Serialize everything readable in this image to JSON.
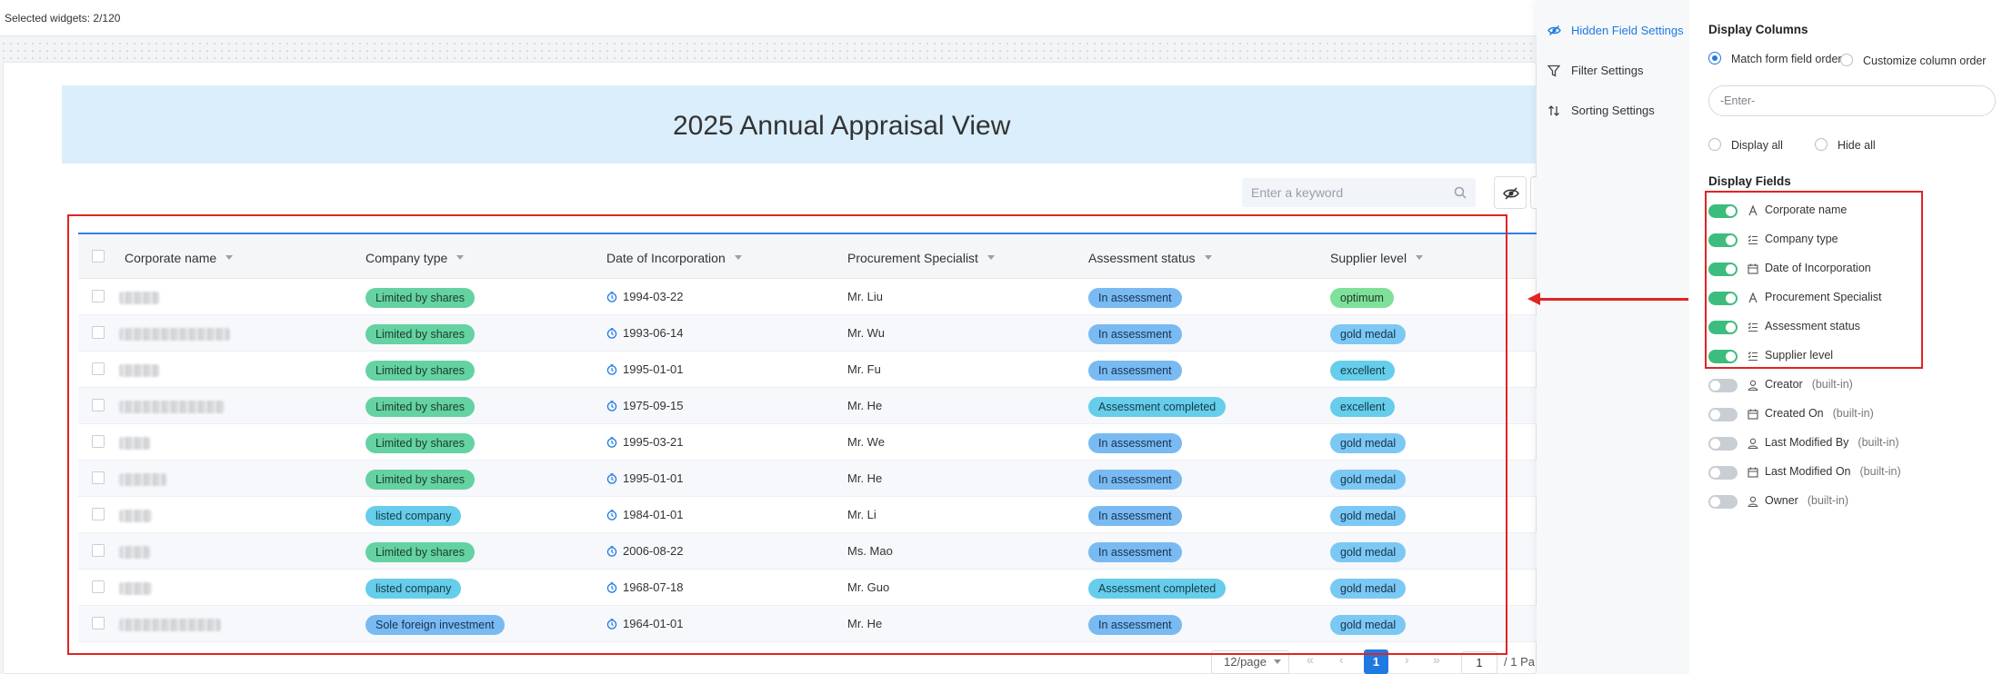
{
  "topbar": {
    "selected": "Selected widgets: 2/120"
  },
  "view": {
    "title": "2025 Annual Appraisal View"
  },
  "search": {
    "placeholder": "Enter a keyword"
  },
  "table": {
    "columns": [
      "Corporate name",
      "Company type",
      "Date of Incorporation",
      "Procurement Specialist",
      "Assessment status",
      "Supplier level"
    ],
    "rows": [
      {
        "company_type": "Limited by shares",
        "type_color": "green",
        "date": "1994-03-22",
        "specialist": "Mr. Liu",
        "status": "In assessment",
        "status_color": "blue",
        "level": "optimum",
        "level_color": "lime"
      },
      {
        "company_type": "Limited by shares",
        "type_color": "green",
        "date": "1993-06-14",
        "specialist": "Mr. Wu",
        "status": "In assessment",
        "status_color": "blue",
        "level": "gold medal",
        "level_color": "sky"
      },
      {
        "company_type": "Limited by shares",
        "type_color": "green",
        "date": "1995-01-01",
        "specialist": "Mr. Fu",
        "status": "In assessment",
        "status_color": "blue",
        "level": "excellent",
        "level_color": "cyan"
      },
      {
        "company_type": "Limited by shares",
        "type_color": "green",
        "date": "1975-09-15",
        "specialist": "Mr. He",
        "status": "Assessment completed",
        "status_color": "cyan",
        "level": "excellent",
        "level_color": "cyan"
      },
      {
        "company_type": "Limited by shares",
        "type_color": "green",
        "date": "1995-03-21",
        "specialist": "Mr. We",
        "status": "In assessment",
        "status_color": "blue",
        "level": "gold medal",
        "level_color": "sky"
      },
      {
        "company_type": "Limited by shares",
        "type_color": "green",
        "date": "1995-01-01",
        "specialist": "Mr. He",
        "status": "In assessment",
        "status_color": "blue",
        "level": "gold medal",
        "level_color": "sky"
      },
      {
        "company_type": "listed company",
        "type_color": "cyan",
        "date": "1984-01-01",
        "specialist": "Mr. Li",
        "status": "In assessment",
        "status_color": "blue",
        "level": "gold medal",
        "level_color": "sky"
      },
      {
        "company_type": "Limited by shares",
        "type_color": "green",
        "date": "2006-08-22",
        "specialist": "Ms. Mao",
        "status": "In assessment",
        "status_color": "blue",
        "level": "gold medal",
        "level_color": "sky"
      },
      {
        "company_type": "listed company",
        "type_color": "cyan",
        "date": "1968-07-18",
        "specialist": "Mr. Guo",
        "status": "Assessment completed",
        "status_color": "cyan",
        "level": "gold medal",
        "level_color": "sky"
      },
      {
        "company_type": "Sole foreign investment",
        "type_color": "blue",
        "date": "1964-01-01",
        "specialist": "Mr. He",
        "status": "In assessment",
        "status_color": "blue",
        "level": "gold medal",
        "level_color": "sky"
      }
    ]
  },
  "pagination": {
    "page_size": "12/page",
    "current": "1",
    "jump": "1",
    "total": "/ 1 Pa"
  },
  "panel": {
    "nav": [
      "Hidden Field Settings",
      "Filter Settings",
      "Sorting Settings"
    ],
    "display_columns": "Display Columns",
    "match_order": "Match form field order",
    "customize_order": "Customize column order",
    "enter_placeholder": "-Enter-",
    "display_all": "Display all",
    "hide_all": "Hide all",
    "display_fields": "Display Fields",
    "fields": [
      {
        "label": "Corporate name",
        "icon": "text-icon",
        "on": true,
        "builtin": ""
      },
      {
        "label": "Company type",
        "icon": "list-icon",
        "on": true,
        "builtin": ""
      },
      {
        "label": "Date of Incorporation",
        "icon": "calendar-icon",
        "on": true,
        "builtin": ""
      },
      {
        "label": "Procurement Specialist",
        "icon": "text-icon",
        "on": true,
        "builtin": ""
      },
      {
        "label": "Assessment status",
        "icon": "list-icon",
        "on": true,
        "builtin": ""
      },
      {
        "label": "Supplier level",
        "icon": "list-icon",
        "on": true,
        "builtin": ""
      },
      {
        "label": "Creator",
        "icon": "user-icon",
        "on": false,
        "builtin": "(built-in)"
      },
      {
        "label": "Created On",
        "icon": "calendar-icon",
        "on": false,
        "builtin": "(built-in)"
      },
      {
        "label": "Last Modified By",
        "icon": "user-icon",
        "on": false,
        "builtin": "(built-in)"
      },
      {
        "label": "Last Modified On",
        "icon": "calendar-icon",
        "on": false,
        "builtin": "(built-in)"
      },
      {
        "label": "Owner",
        "icon": "user-icon",
        "on": false,
        "builtin": "(built-in)"
      }
    ]
  }
}
